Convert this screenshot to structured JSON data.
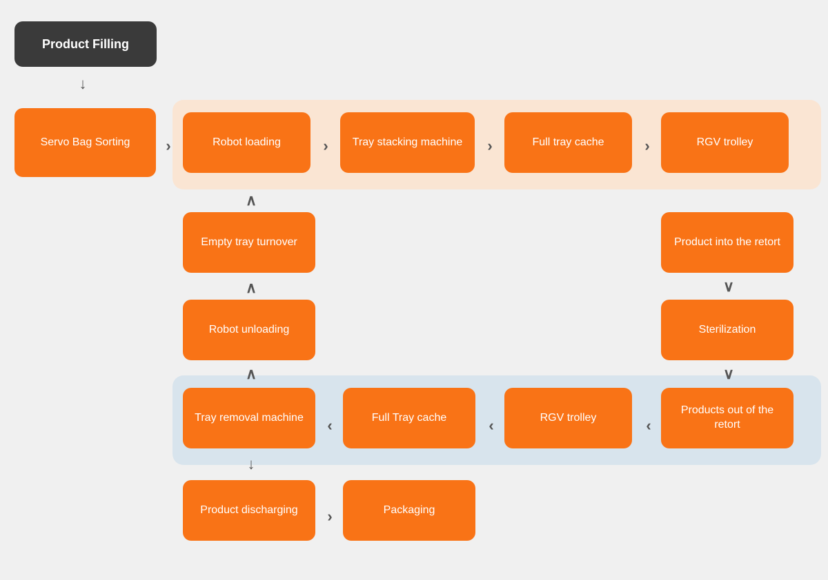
{
  "boxes": {
    "product_filling": "Product Filling",
    "servo_bag_sorting": "Servo Bag\nSorting",
    "robot_loading": "Robot loading",
    "tray_stacking_machine": "Tray stacking\nmachine",
    "full_tray_cache": "Full tray cache",
    "rgv_trolley_top": "RGV trolley",
    "empty_tray_turnover": "Empty tray\nturnover",
    "robot_unloading": "Robot\nunloading",
    "product_into_retort": "Product into\nthe retort",
    "sterilization": "Sterilization",
    "tray_removal_machine": "Tray removal\nmachine",
    "full_tray_cache_bottom": "Full Tray\ncache",
    "rgv_trolley_bottom": "RGV trolley",
    "products_out_retort": "Products out\nof the retort",
    "product_discharging": "Product\ndischarging",
    "packaging": "Packaging"
  },
  "colors": {
    "orange": "#F97316",
    "dark": "#3a3a3a",
    "arrow": "#555",
    "panel_orange_bg": "#fae5d3",
    "panel_blue_bg": "#d8e4ed"
  }
}
